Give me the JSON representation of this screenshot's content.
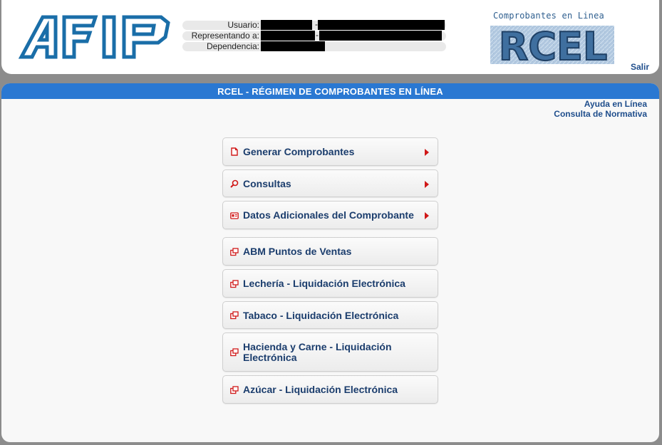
{
  "header": {
    "afip_logo_text": "AFIP",
    "user_labels": {
      "usuario": "Usuario:",
      "representando": "Representando a:",
      "dependencia": "Dependencia:"
    },
    "separator": "-",
    "rcel_caption": "Comprobantes en Linea",
    "rcel_logo_text": "RCEL",
    "salir_label": "Salir"
  },
  "main": {
    "title": "RCEL - RÉGIMEN DE COMPROBANTES EN LÍNEA",
    "side_links": [
      "Ayuda en Línea",
      "Consulta de Normativa"
    ],
    "menu": [
      {
        "label": "Generar Comprobantes",
        "icon": "document-icon",
        "submenu": true
      },
      {
        "label": "Consultas",
        "icon": "magnifier-icon",
        "submenu": true
      },
      {
        "label": "Datos Adicionales del Comprobante",
        "icon": "id-card-icon",
        "submenu": true
      },
      {
        "label": "ABM Puntos de Ventas",
        "icon": "external-window-icon",
        "submenu": false
      },
      {
        "label": "Lechería - Liquidación Electrónica",
        "icon": "external-window-icon",
        "submenu": false
      },
      {
        "label": "Tabaco - Liquidación Electrónica",
        "icon": "external-window-icon",
        "submenu": false
      },
      {
        "label": "Hacienda y Carne - Liquidación Electrónica",
        "icon": "external-window-icon",
        "submenu": false
      },
      {
        "label": "Azúcar - Liquidación Electrónica",
        "icon": "external-window-icon",
        "submenu": false
      }
    ]
  },
  "colors": {
    "title_bar": "#2a78d2",
    "link": "#1f4e8c",
    "menu_text": "#1b3d6d",
    "arrow": "#d01818",
    "icon": "#d01818",
    "afip_logo": "#1a6ea8"
  }
}
